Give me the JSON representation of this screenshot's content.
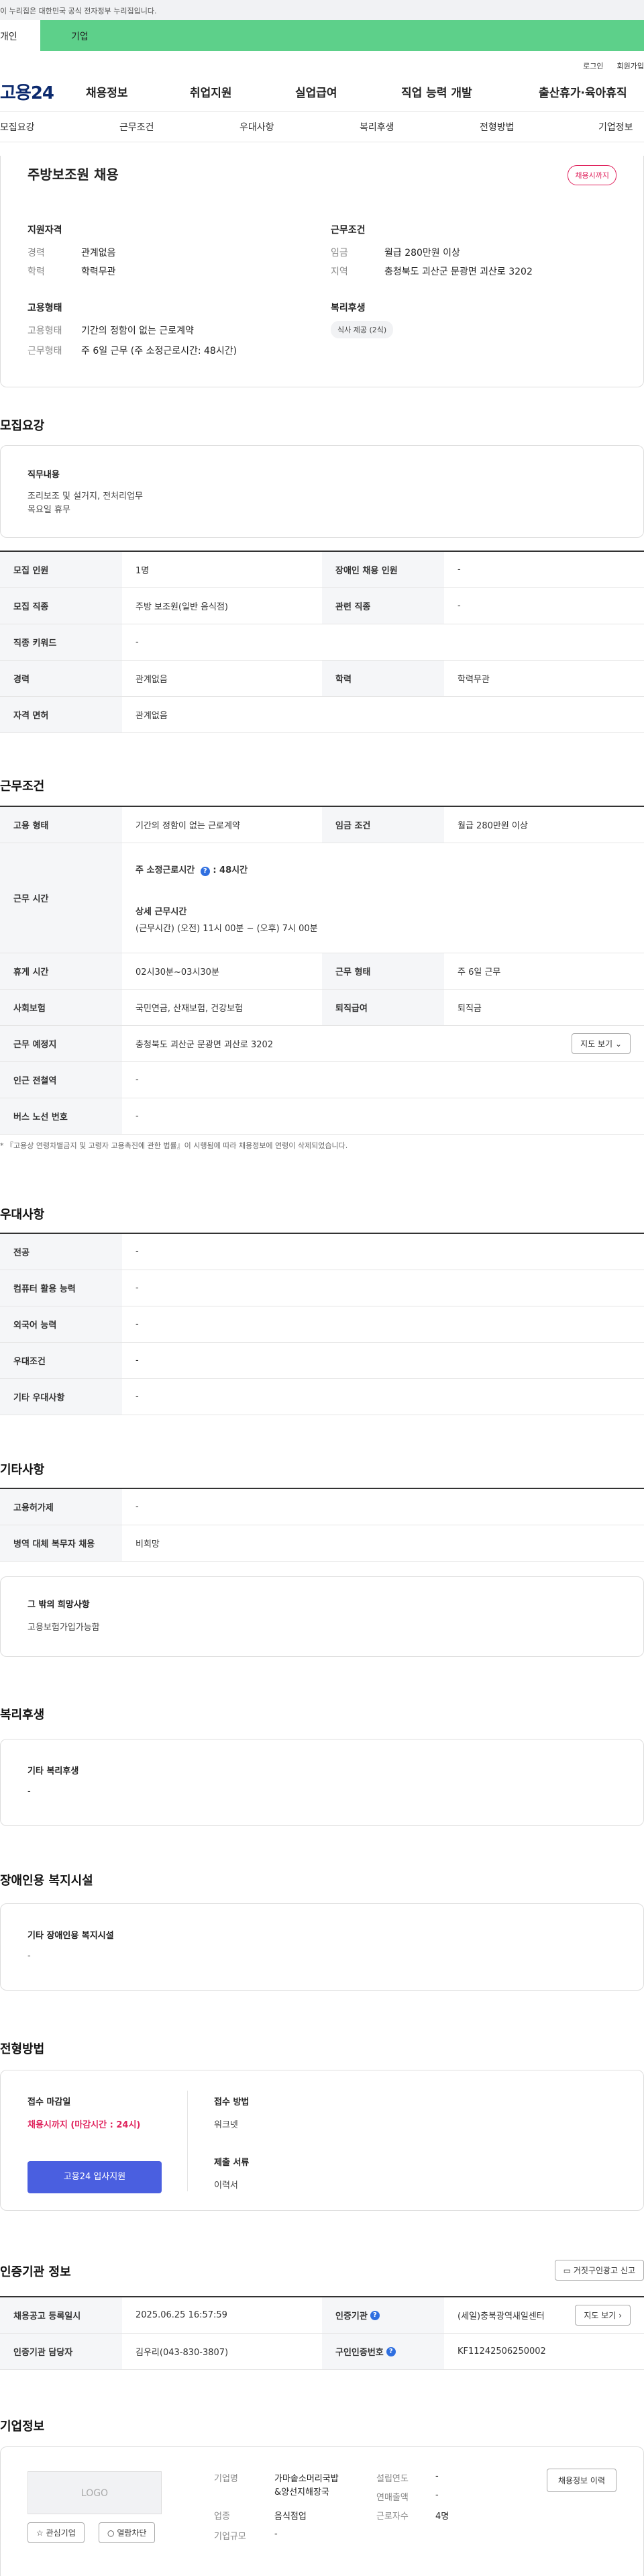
{
  "banner": {
    "text": "이 누리집은 대한민국 공식 전자정부 누리집입니다."
  },
  "user_tabs": {
    "personal": "개인",
    "corporate": "기업"
  },
  "util": {
    "login": "로그인",
    "signup": "회원가입"
  },
  "gnb": {
    "logo": "고용24",
    "items": [
      "채용정보",
      "취업지원",
      "실업급여",
      "직업 능력 개발",
      "출산휴가·육아휴직"
    ]
  },
  "subnav": [
    "모집요강",
    "근무조건",
    "우대사항",
    "복리후생",
    "전형방법",
    "기업정보"
  ],
  "job": {
    "title": "주방보조원 채용",
    "status": "채용시까지",
    "qual_heading": "지원자격",
    "qual": [
      {
        "k": "경력",
        "v": "관계없음"
      },
      {
        "k": "학력",
        "v": "학력무관"
      }
    ],
    "work_heading": "근무조건",
    "work": [
      {
        "k": "임금",
        "v": "월급 280만원 이상"
      },
      {
        "k": "지역",
        "v": "충청북도 괴산군 문광면 괴산로 3202"
      }
    ],
    "emp_heading": "고용형태",
    "emp": [
      {
        "k": "고용형태",
        "v": "기간의 정함이 없는 근로계약"
      },
      {
        "k": "근무형태",
        "v": "주 6일 근무 (주 소정근로시간: 48시간)"
      }
    ],
    "welfare_heading": "복리후생",
    "welfare_tag": "식사 제공 (2식)"
  },
  "recruit": {
    "title": "모집요강",
    "duty_heading": "직무내용",
    "duty_text_1": "조리보조 및 설거지, 전처리업무",
    "duty_text_2": "목요일 휴무",
    "rows": [
      {
        "k1": "모집 인원",
        "v1": "1명",
        "k2": "장애인 채용 인원",
        "v2": "-"
      },
      {
        "k1": "모집 직종",
        "v1": "주방 보조원(일반 음식점)",
        "k2": "관련 직종",
        "v2": "-"
      },
      {
        "k1": "직종 키워드",
        "v1": "-"
      },
      {
        "k1": "경력",
        "v1": "관계없음",
        "k2": "학력",
        "v2": "학력무관"
      },
      {
        "k1": "자격 면허",
        "v1": "관계없음"
      }
    ]
  },
  "conditions": {
    "title": "근무조건",
    "type_label": "고용 형태",
    "type_value": "기간의 정함이 없는 근로계약",
    "wage_label": "임금 조건",
    "wage_value": "월급 280만원 이상",
    "hours_label": "근무 시간",
    "hours_main": "주 소정근로시간",
    "hours_main_value": ": 48시간",
    "hours_detail_heading": "상세 근무시간",
    "hours_detail": "(근무시간) (오전) 11시 00분 ~ (오후) 7시 00분",
    "break_label": "휴게 시간",
    "break_value": "02시30분~03시30분",
    "shift_label": "근무 형태",
    "shift_value": "주 6일 근무",
    "insurance_label": "사회보험",
    "insurance_value": "국민연금, 산재보험, 건강보험",
    "severance_label": "퇴직급여",
    "severance_value": "퇴직금",
    "place_label": "근무 예정지",
    "place_value": "충청북도 괴산군 문광면 괴산로 3202",
    "map_button": "지도 보기",
    "subway_label": "인근 전철역",
    "subway_value": "-",
    "bus_label": "버스 노선 번호",
    "bus_value": "-",
    "note": "* 『고용상 연령차별금지 및 고령자 고용촉진에 관한 법률』이 시행됨에 따라 채용정보에 연령이 삭제되었습니다."
  },
  "prefer": {
    "title": "우대사항",
    "rows": [
      {
        "k": "전공",
        "v": "-"
      },
      {
        "k": "컴퓨터 활용 능력",
        "v": "-"
      },
      {
        "k": "외국어 능력",
        "v": "-"
      },
      {
        "k": "우대조건",
        "v": "-"
      },
      {
        "k": "기타 우대사항",
        "v": "-"
      }
    ]
  },
  "etc": {
    "title": "기타사항",
    "rows": [
      {
        "k": "고용허가제",
        "v": "-"
      },
      {
        "k": "병역 대체 복무자 채용",
        "v": "비희망"
      }
    ],
    "hope_heading": "그 밖의 희망사항",
    "hope_text": "고용보험가입가능함"
  },
  "welfare": {
    "title": "복리후생",
    "heading": "기타 복리후생",
    "value": "-"
  },
  "disabled": {
    "title": "장애인용 복지시설",
    "heading": "기타 장애인용 복지시설",
    "value": "-"
  },
  "selection": {
    "title": "전형방법",
    "deadline_label": "접수 마감일",
    "deadline_value": "채용시까지 (마감시간 : 24시)",
    "method_label": "접수 방법",
    "method_value": "워크넷",
    "docs_label": "제출 서류",
    "docs_value": "이력서",
    "apply_button": "고용24 입사지원"
  },
  "agency": {
    "title": "인증기관 정보",
    "report_button": "거짓구인광고 신고",
    "reg_label": "채용공고 등록일시",
    "reg_value": "2025.06.25 16:57:59",
    "org_label": "인증기관",
    "org_value": "(세일)충북광역새일센터",
    "manager_label": "인증기관 담당자",
    "manager_value": "김우리(043-830-3807)",
    "id_label": "구인인증번호",
    "id_value": "KF11242506250002",
    "map_button": "지도 보기"
  },
  "company": {
    "title": "기업정보",
    "logo": "LOGO",
    "interest_button": "관심기업",
    "block_button": "열람차단",
    "name_label": "기업명",
    "name_value_1": "가마솥소머리국밥",
    "name_value_2": "&양선지해장국",
    "industry_label": "업종",
    "industry_value": "음식점업",
    "size_label": "기업규모",
    "size_value": "-",
    "founded_label": "설립연도",
    "founded_value": "-",
    "revenue_label": "연매출액",
    "revenue_value": "-",
    "employees_label": "근로자수",
    "employees_value": "4명",
    "history_button": "채용정보 이력"
  }
}
